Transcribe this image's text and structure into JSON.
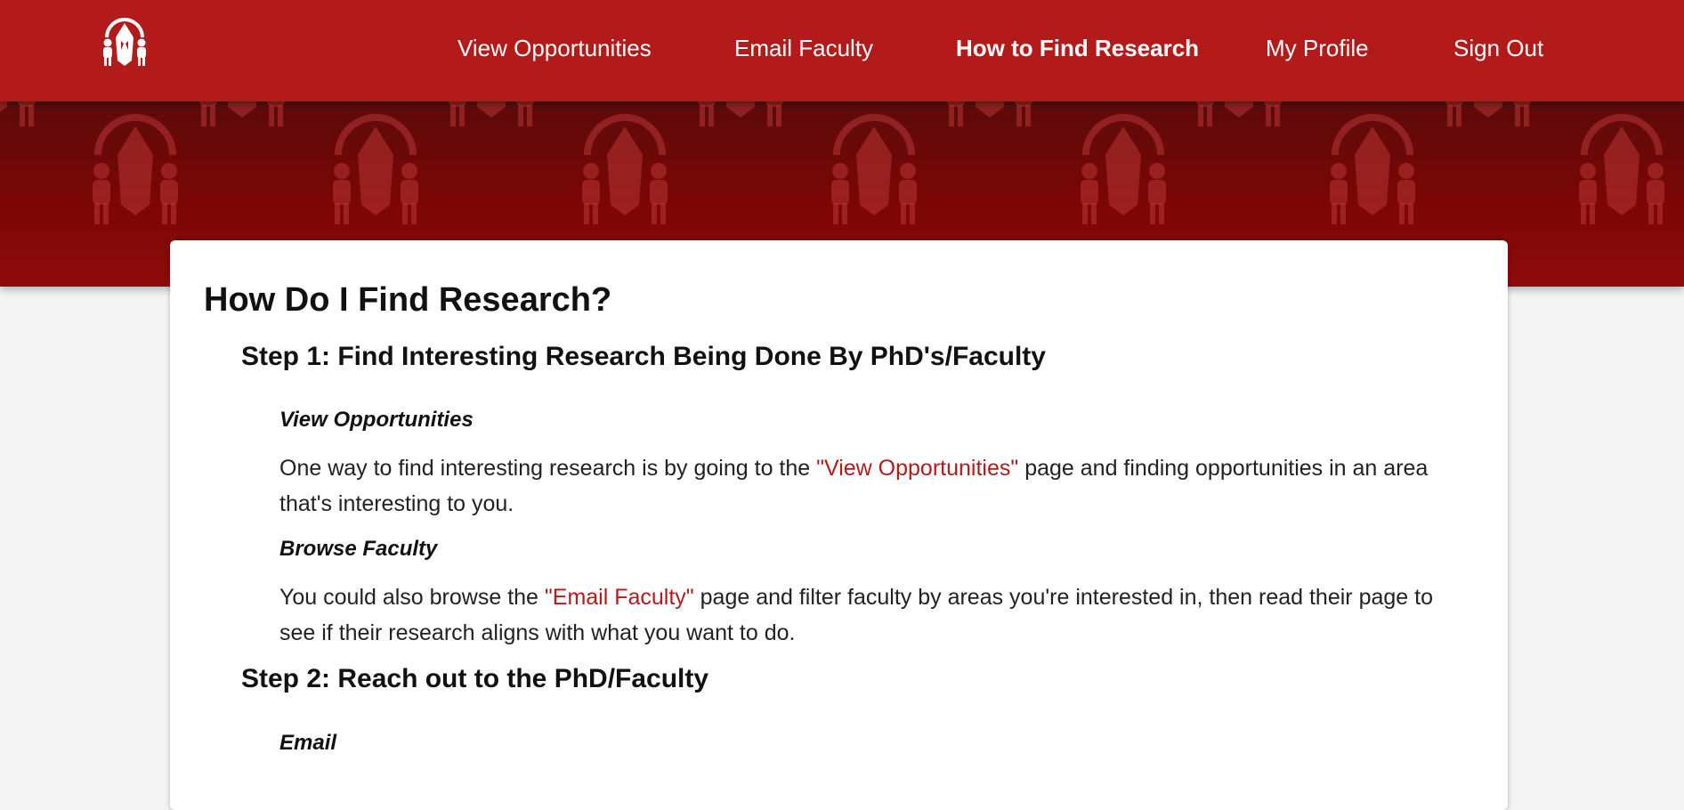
{
  "nav": {
    "logo_icon": "lab-team-logo-icon",
    "items": [
      {
        "label": "View Opportunities",
        "active": false
      },
      {
        "label": "Email Faculty",
        "active": false
      },
      {
        "label": "How to Find Research",
        "active": true
      },
      {
        "label": "My Profile",
        "active": false
      },
      {
        "label": "Sign Out",
        "active": false
      }
    ]
  },
  "hero": {
    "pattern_icon": "logo-pattern-icon"
  },
  "colors": {
    "brand_red": "#b31b1b",
    "hero_dark": "#6b0808",
    "link": "#b31b1b",
    "page_bg": "#f3f3f3"
  },
  "content": {
    "title": "How Do I Find Research?",
    "step1": {
      "heading": "Step 1: Find Interesting Research Being Done By PhD's/Faculty",
      "sections": [
        {
          "heading": "View Opportunities",
          "before": "One way to find interesting research is by going to the ",
          "link": "\"View Opportunities\"",
          "after": " page and finding opportunities in an area that's interesting to you."
        },
        {
          "heading": "Browse Faculty",
          "before": "You could also browse the ",
          "link": "\"Email Faculty\"",
          "after": " page and filter faculty by areas you're interested in, then read their page to see if their research aligns with what you want to do."
        }
      ]
    },
    "step2": {
      "heading": "Step 2: Reach out to the PhD/Faculty",
      "sections": [
        {
          "heading": "Email"
        }
      ]
    }
  }
}
